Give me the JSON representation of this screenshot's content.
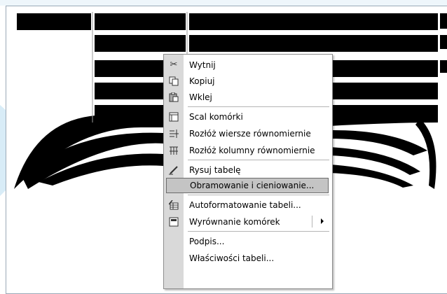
{
  "context_menu": {
    "items": [
      {
        "label": "Wytnij",
        "icon": "scissors-icon"
      },
      {
        "label": "Kopiuj",
        "icon": "copy-icon"
      },
      {
        "label": "Wklej",
        "icon": "paste-icon"
      },
      {
        "label": "Scal komórki",
        "icon": "merge-cells-icon"
      },
      {
        "label": "Rozłóż wiersze równomiernie",
        "icon": "distribute-rows-icon"
      },
      {
        "label": "Rozłóż kolumny równomiernie",
        "icon": "distribute-columns-icon"
      },
      {
        "label": "Rysuj tabelę",
        "icon": "pencil-icon"
      },
      {
        "label": "Obramowanie i cieniowanie...",
        "icon": "",
        "highlighted": true
      },
      {
        "label": "Autoformatowanie tabeli...",
        "icon": "table-autoformat-icon"
      },
      {
        "label": "Wyrównanie komórek",
        "icon": "cell-alignment-icon",
        "submenu": true
      },
      {
        "label": "Podpis...",
        "icon": ""
      },
      {
        "label": "Właściwości tabeli...",
        "icon": ""
      }
    ]
  },
  "colors": {
    "page_border": "#9aa9b7",
    "cell_fill": "#000000",
    "menu_gutter": "#d9d9d9",
    "menu_highlight": "#c4c4c4",
    "background_accent": "#cfe8f6"
  }
}
